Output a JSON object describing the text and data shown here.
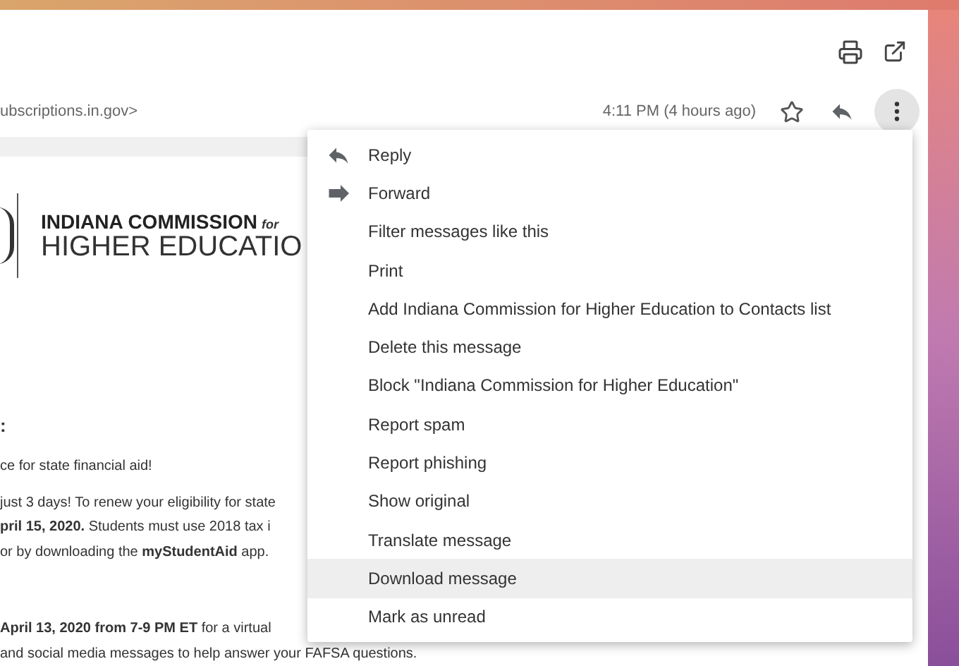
{
  "header": {
    "sender_address": "ubscriptions.in.gov>",
    "time": "4:11 PM (4 hours ago)",
    "more_button_active": true
  },
  "logo": {
    "line_1": "INDIANA COMMISSION",
    "line_1_suffix": "for",
    "line_2": "HIGHER EDUCATIO"
  },
  "body": {
    "heading": ":",
    "paragraphs": [
      {
        "lines": [
          "ce for state financial aid!"
        ]
      },
      {
        "lines": [
          "just 3 days! To renew your eligibility for state",
          "**pril 15, 2020.** Students must use 2018 tax i",
          "or by downloading the **myStudentAid** app."
        ]
      },
      {
        "lines": [
          "**April 13, 2020 from 7-9 PM ET** for a virtual",
          "and social media messages to help answer your FAFSA questions."
        ]
      }
    ]
  },
  "menu": {
    "items": [
      {
        "label": "Reply",
        "kind": "reply",
        "highlighted": false
      },
      {
        "label": "Forward",
        "kind": "forward",
        "highlighted": false
      },
      {
        "label": "Filter messages like this",
        "kind": "plain",
        "highlighted": false
      },
      {
        "label": "Print",
        "kind": "plain",
        "highlighted": false
      },
      {
        "label": "Add Indiana Commission for Higher Education to Contacts list",
        "kind": "plain",
        "highlighted": false
      },
      {
        "label": "Delete this message",
        "kind": "plain",
        "highlighted": false
      },
      {
        "label": "Block \"Indiana Commission for Higher Education\"",
        "kind": "plain",
        "highlighted": false
      },
      {
        "label": "Report spam",
        "kind": "plain",
        "highlighted": false
      },
      {
        "label": "Report phishing",
        "kind": "plain",
        "highlighted": false
      },
      {
        "label": "Show original",
        "kind": "plain",
        "highlighted": false
      },
      {
        "label": "Translate message",
        "kind": "plain",
        "highlighted": false
      },
      {
        "label": "Download message",
        "kind": "plain",
        "highlighted": true
      },
      {
        "label": "Mark as unread",
        "kind": "plain",
        "highlighted": false
      }
    ]
  }
}
